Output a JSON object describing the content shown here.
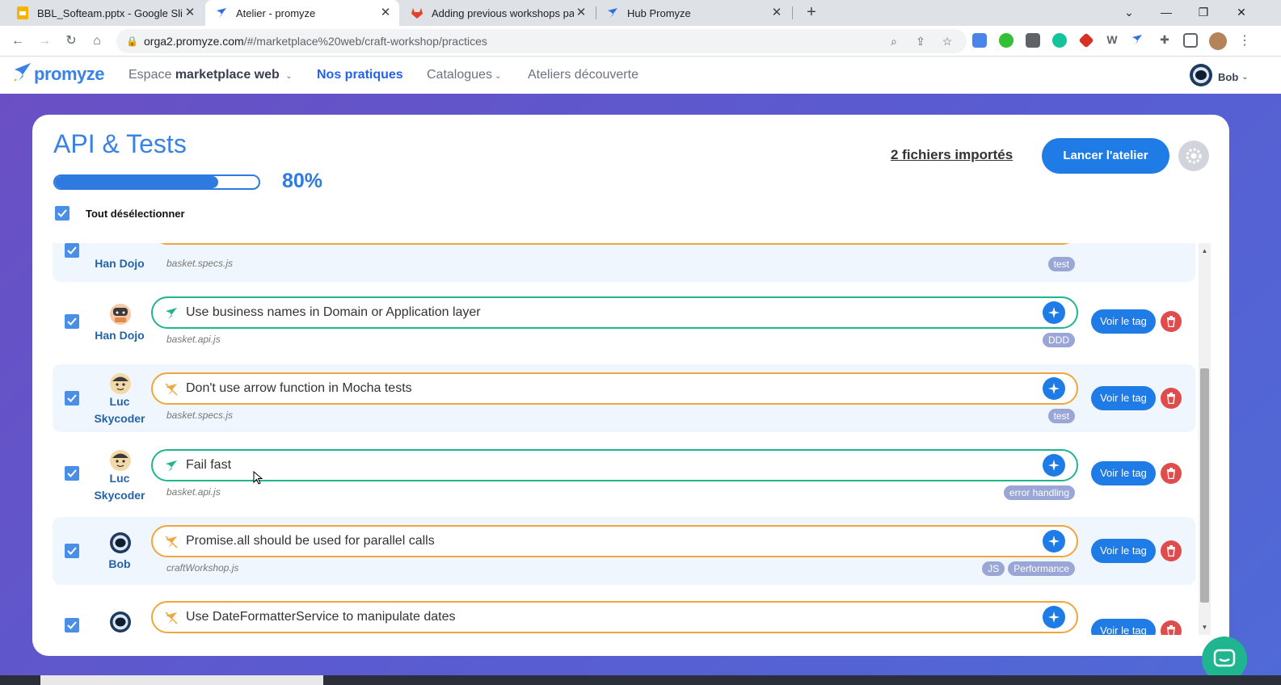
{
  "browser": {
    "tabs": [
      {
        "title": "BBL_Softeam.pptx - Google Slides",
        "favicon": "google-slides-icon",
        "active": false
      },
      {
        "title": "Atelier - promyze",
        "favicon": "promyze-rocket-icon",
        "active": true
      },
      {
        "title": "Adding previous workshops page",
        "favicon": "gitlab-icon",
        "active": false
      },
      {
        "title": "Hub Promyze",
        "favicon": "promyze-rocket-icon",
        "active": false
      }
    ],
    "url_host": "orga2.promyze.com",
    "url_path": "/#/marketplace%20web/craft-workshop/practices"
  },
  "header": {
    "logo": "promyze",
    "space_prefix": "Espace",
    "space_name": "marketplace web",
    "nav": [
      "Nos pratiques",
      "Catalogues",
      "Ateliers découverte"
    ],
    "user": "Bob"
  },
  "workshop": {
    "title": "API & Tests",
    "progress_percent": 80,
    "progress_label": "80%",
    "select_all_label": "Tout désélectionner",
    "imported_link": "2 fichiers importés",
    "launch_button": "Lancer l'atelier"
  },
  "practices": [
    {
      "author": "Han Dojo",
      "title": "",
      "file": "basket.specs.js",
      "tags": [
        "test"
      ],
      "kind": "orange",
      "checked": true
    },
    {
      "author": "Han Dojo",
      "title": "Use business names in Domain or Application layer",
      "file": "basket.api.js",
      "tags": [
        "DDD"
      ],
      "kind": "green",
      "checked": true
    },
    {
      "author": "Luc Skycoder",
      "title": "Don't use arrow function in Mocha tests",
      "file": "basket.specs.js",
      "tags": [
        "test"
      ],
      "kind": "orange",
      "checked": true
    },
    {
      "author": "Luc Skycoder",
      "title": "Fail fast",
      "file": "basket.api.js",
      "tags": [
        "error handling"
      ],
      "kind": "green",
      "checked": true
    },
    {
      "author": "Bob",
      "title": "Promise.all should be used for parallel calls",
      "file": "craftWorkshop.js",
      "tags": [
        "JS",
        "Performance"
      ],
      "kind": "orange",
      "checked": true
    },
    {
      "author": "",
      "title": "Use DateFormatterService to manipulate dates",
      "file": "",
      "tags": [],
      "kind": "orange",
      "checked": true
    }
  ],
  "row_action_label": "Voir le tag",
  "colors": {
    "primary": "#1f7be6",
    "green": "#1fb58f",
    "orange": "#f0a63a",
    "danger": "#e04b4b"
  }
}
